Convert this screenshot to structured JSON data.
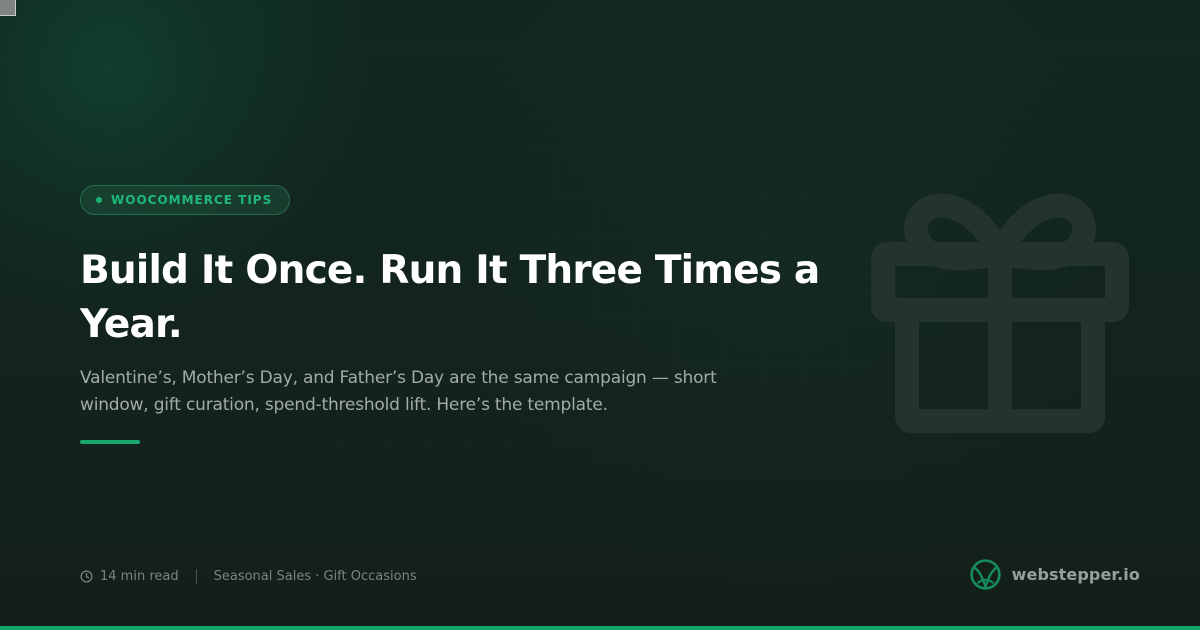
{
  "card": {
    "category_badge": "WOOCOMMERCE TIPS",
    "headline": "Build It Once. Run It Three Times a Year.",
    "subtitle": "Valentine’s, Mother’s Day, and Father’s Day are the same campaign — short window, gift curation, spend-threshold lift. Here’s the template.",
    "meta": {
      "read_time": "14 min read",
      "tags": "Seasonal Sales · Gift Occasions"
    },
    "brand": {
      "name": "webstepper.io"
    }
  },
  "icons": {
    "illustration": "gift-icon",
    "read_time": "clock-icon",
    "brand": "webstepper-logo-icon"
  },
  "colors": {
    "background": "#13231e",
    "accent": "#1aa76d",
    "badge_text": "#20b97a",
    "headline": "#ffffff",
    "body": "#a2aba7",
    "meta": "#7b8380"
  }
}
